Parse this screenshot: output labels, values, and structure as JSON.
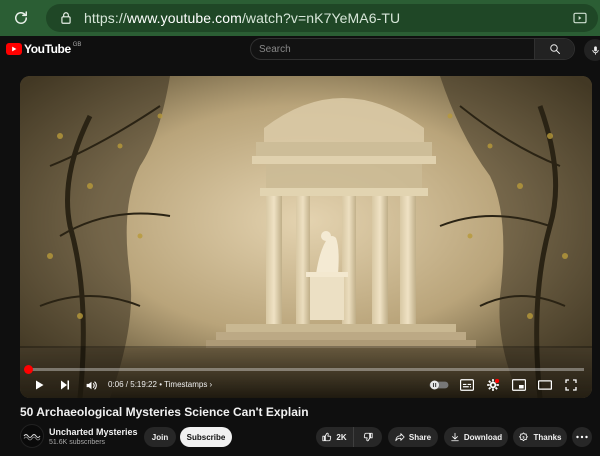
{
  "browser": {
    "url_prefix": "https://",
    "url_host": "www.youtube.com",
    "url_path": "/watch?v=nK7YeMA6-TU"
  },
  "header": {
    "logo_text": "YouTube",
    "country_code": "GB",
    "search_placeholder": "Search"
  },
  "player": {
    "current_time": "0:06",
    "separator": " / ",
    "duration": "5:19:22",
    "chapter_label": "• Timestamps ›",
    "progress_fraction": 0.0003
  },
  "video": {
    "title": "50 Archaeological Mysteries Science Can't Explain"
  },
  "channel": {
    "name": "Uncharted Mysteries",
    "subscribers": "51.6K subscribers",
    "join_label": "Join",
    "subscribe_label": "Subscribe"
  },
  "actions": {
    "like_count": "2K",
    "share_label": "Share",
    "download_label": "Download",
    "thanks_label": "Thanks"
  },
  "colors": {
    "browser_bar": "#2b5e34",
    "accent_red": "#ff0000",
    "page_bg": "#0f0f0f"
  }
}
